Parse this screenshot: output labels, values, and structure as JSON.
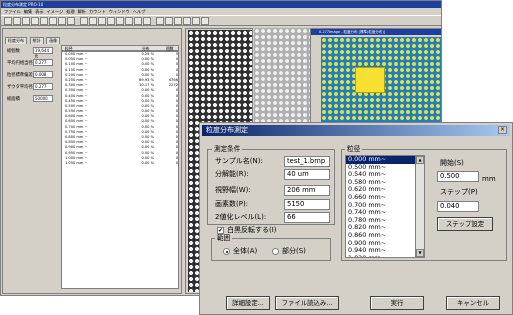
{
  "main": {
    "title": "粒度分布測定 PRO-10",
    "menu": [
      "ファイル",
      "編集",
      "表示",
      "イメージ",
      "処理",
      "解析",
      "カウント",
      "ウィンドウ",
      "ヘルプ"
    ]
  },
  "stats": {
    "tabs": [
      "粒度分布",
      "統計",
      "画像"
    ],
    "rows": [
      {
        "label": "総個数",
        "value": "19,644 ft"
      },
      {
        "label": "平均円相当径",
        "value": "0.277"
      },
      {
        "label": "粒径標準偏差",
        "value": "0.008"
      },
      {
        "label": "ザウタ平均径",
        "value": "0.277"
      },
      {
        "label": "総面積",
        "value": "50000"
      }
    ],
    "list_headers": [
      "粒径",
      "分布",
      "個数"
    ],
    "list_rows": [
      [
        "0.000 mm ~",
        "0.25 %",
        "5"
      ],
      [
        "0.050 mm ~",
        "0.00 %",
        "0"
      ],
      [
        "0.100 mm ~",
        "0.00 %",
        "0"
      ],
      [
        "0.150 mm ~",
        "0.00 %",
        "0"
      ],
      [
        "0.200 mm ~",
        "0.00 %",
        "0"
      ],
      [
        "0.250 mm ~",
        "89.93 %",
        "4766"
      ],
      [
        "0.300 mm ~",
        "10.17 %",
        "2272"
      ],
      [
        "0.350 mm ~",
        "0.00 %",
        "0"
      ],
      [
        "0.400 mm ~",
        "0.00 %",
        "0"
      ],
      [
        "0.450 mm ~",
        "0.00 %",
        "0"
      ],
      [
        "0.500 mm ~",
        "0.00 %",
        "0"
      ],
      [
        "0.550 mm ~",
        "0.00 %",
        "0"
      ],
      [
        "0.600 mm ~",
        "0.00 %",
        "0"
      ],
      [
        "0.650 mm ~",
        "0.00 %",
        "0"
      ],
      [
        "0.700 mm ~",
        "0.00 %",
        "0"
      ],
      [
        "0.750 mm ~",
        "0.00 %",
        "0"
      ],
      [
        "0.800 mm ~",
        "0.00 %",
        "0"
      ],
      [
        "0.850 mm ~",
        "0.00 %",
        "0"
      ],
      [
        "0.900 mm ~",
        "0.00 %",
        "0"
      ],
      [
        "0.950 mm ~",
        "0.00 %",
        "0"
      ],
      [
        "1.000 mm ~",
        "0.00 %",
        "0"
      ],
      [
        "1.050 mm ~",
        "0.00 %",
        "0"
      ]
    ]
  },
  "subwindow": {
    "title": "0.277Image - 粒度分布 [標準(粒度分布)]"
  },
  "dialog": {
    "title": "粒度分布測定",
    "close": "×",
    "conditions_group": "測定条件",
    "sample_label": "サンプル名(N):",
    "sample_value": "test_1.bmp",
    "resolution_label": "分解能(R):",
    "resolution_value": "40 um",
    "fov_label": "視野幅(W):",
    "fov_value": "206 mm",
    "pixels_label": "画素数(P):",
    "pixels_value": "5150",
    "binarize_label": "2値化レベル(L):",
    "binarize_value": "66",
    "invert_label": "白黒反転する(I)",
    "invert_checked": "✔",
    "range_group": "範囲",
    "range_all": "全体(A)",
    "range_part": "部分(S)",
    "size_group": "粒径",
    "size_ranges": [
      "0.000 mm~",
      "0.500 mm~",
      "0.540 mm~",
      "0.580 mm~",
      "0.620 mm~",
      "0.660 mm~",
      "0.700 mm~",
      "0.740 mm~",
      "0.780 mm~",
      "0.820 mm~",
      "0.860 mm~",
      "0.900 mm~",
      "0.940 mm~",
      "1.020 mm~",
      "1.060 mm~"
    ],
    "start_label": "開始(S)",
    "start_value": "0.500",
    "start_unit": "mm",
    "step_label": "ステップ(P)",
    "step_value": "0.040",
    "step_button": "ステップ設定",
    "detail_button": "詳細設定...",
    "load_button": "ファイル読込み...",
    "run_button": "実行",
    "cancel_button": "キャンセル"
  }
}
